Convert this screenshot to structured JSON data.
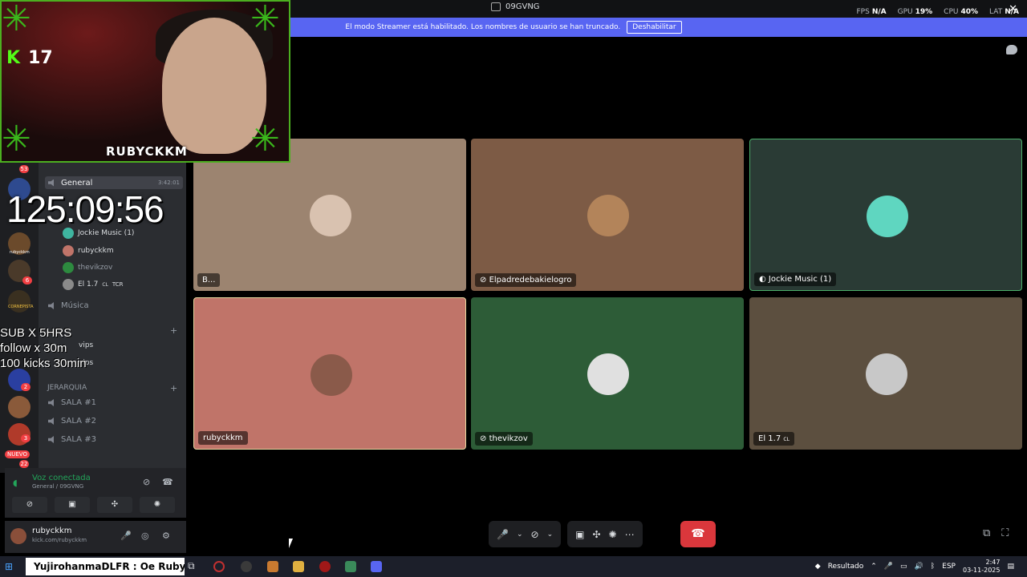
{
  "window": {
    "title": "09GVNG"
  },
  "stats": {
    "fps_label": "FPS",
    "fps_value": "N/A",
    "gpu_label": "GPU",
    "gpu_value": "19%",
    "cpu_label": "CPU",
    "cpu_value": "40%",
    "lat_label": "LAT",
    "lat_value": "N/A"
  },
  "banner": {
    "text": "El modo Streamer está habilitado. Los nombres de usuario se han truncado.",
    "button": "Deshabilitar"
  },
  "server_badges": [
    "53",
    "6",
    "2",
    "3",
    "22"
  ],
  "server_labels": {
    "rubyckkm": "rubyckkm",
    "cornerista": "CORNEPISTA"
  },
  "nuevo": "NUEVO",
  "channels": {
    "general": {
      "label": "General",
      "time": "3:42:01"
    },
    "members": [
      {
        "name": "Jockie Music (1)"
      },
      {
        "name": "rubyckkm"
      },
      {
        "name": "thevikzov"
      },
      {
        "name": "El 1.7",
        "tag": "CL",
        "extra": "TCR"
      }
    ],
    "musica": "Música",
    "vips1": "vips",
    "vips2": "vips",
    "jerarquia": "JERARQUIA",
    "salas": [
      "SALA #1",
      "SALA #2",
      "SALA #3"
    ]
  },
  "voice": {
    "status": "Voz conectada",
    "sub": "General / 09GVNG"
  },
  "user": {
    "name": "rubyckkm",
    "sub": "kick.com/rubyckkm"
  },
  "tiles": [
    {
      "label": "B...",
      "bg": "#9c8470"
    },
    {
      "label": "Elpadredebakielogro",
      "bg": "#7d5b45"
    },
    {
      "label": "Jockie Music (1)",
      "bg": "#2a3b35"
    },
    {
      "label": "rubyckkm",
      "bg": "#c07469"
    },
    {
      "label": "thevikzov",
      "bg": "#2d5c37"
    },
    {
      "label": "El 1.7",
      "tag": "CL",
      "bg": "#5c4f3f"
    }
  ],
  "overlay": {
    "kick_count": "17",
    "cam_name": "RUBYCKKM",
    "timer": "125:09:56",
    "goals": [
      "SUB X 5HRS",
      "follow x 30m",
      "100 kicks 30min"
    ]
  },
  "taskbar": {
    "ticker": "YujirohanmaDLFR : Oe Ruby",
    "tray_label": "Resultado",
    "lang": "ESP",
    "time": "2:47",
    "date": "03-11-2025"
  },
  "colors": {
    "accent": "#5865f2",
    "hangup": "#da373c",
    "green": "#23a55a"
  }
}
